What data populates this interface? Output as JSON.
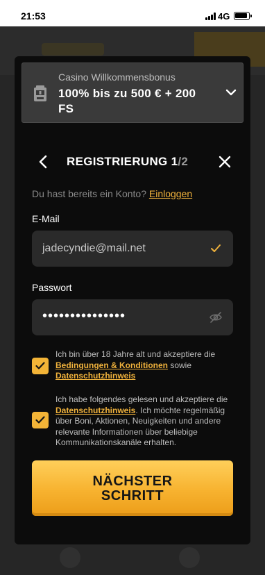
{
  "status_bar": {
    "time": "21:53",
    "network": "4G"
  },
  "bonus": {
    "label": "Casino Willkommensbonus",
    "title": "100% bis zu 500 € + 200 FS"
  },
  "registration": {
    "title_prefix": "REGISTRIERUNG 1",
    "title_total": "/2",
    "existing_account_text": "Du hast bereits ein Konto?",
    "login_link": "Einloggen"
  },
  "form": {
    "email_label": "E-Mail",
    "email_value": "jadecyndie@mail.net",
    "password_label": "Passwort",
    "password_value": "•••••••••••••••"
  },
  "consents": [
    {
      "text_1": "Ich bin über 18 Jahre alt und akzeptiere die ",
      "link_1": "Bedingungen & Konditionen",
      "text_2": " sowie ",
      "link_2": "Datenschutzhinweis",
      "checked": true
    },
    {
      "text_1": "Ich habe folgendes gelesen und akzeptiere die ",
      "link_1": "Datenschutzhinweis",
      "text_2": ". Ich möchte regelmäßig über Boni, Aktionen, Neuigkeiten und andere relevante Informationen über beliebige Kommunikationskanäle erhalten.",
      "checked": true
    }
  ],
  "next_button": "NÄCHSTER\nSCHRITT",
  "colors": {
    "accent": "#f3b437",
    "link": "#f0b23c",
    "modal_bg": "#0c0c0c",
    "input_bg": "#2a2a2a"
  }
}
